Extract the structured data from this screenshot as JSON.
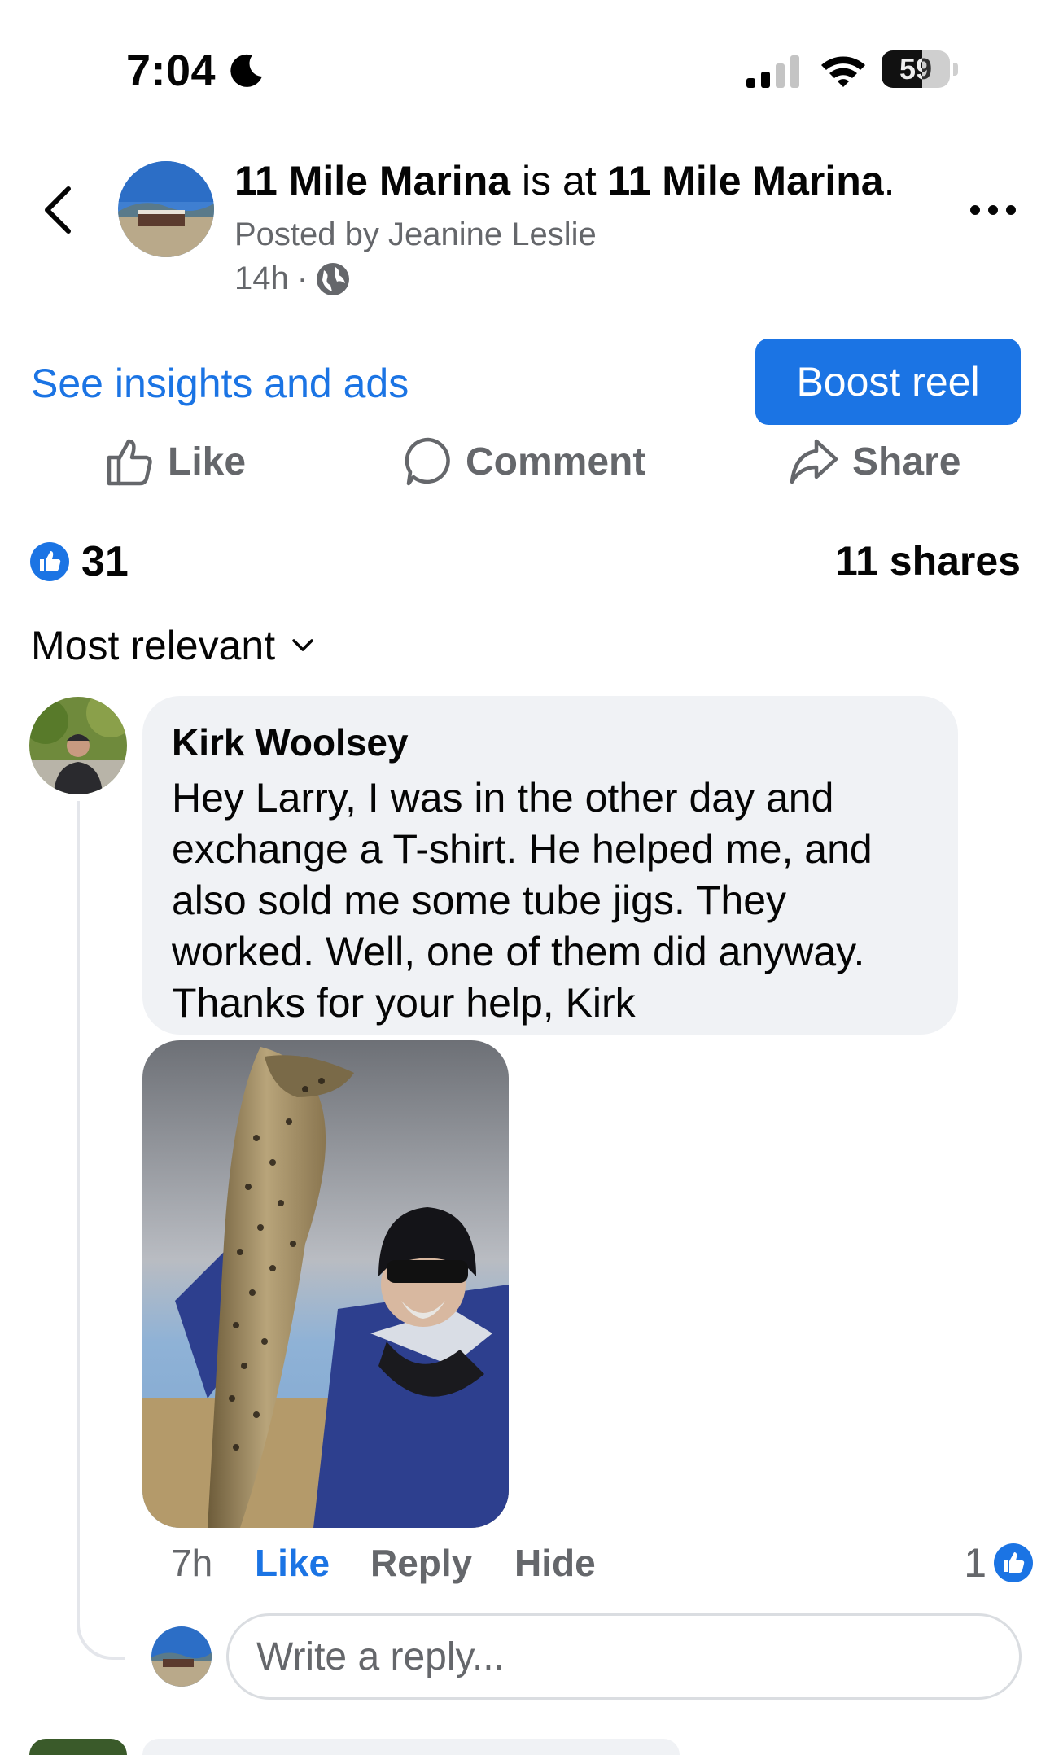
{
  "status_bar": {
    "time": "7:04",
    "battery": "59",
    "battery_level": 0.59
  },
  "header": {
    "page_name": "11 Mile Marina",
    "connector": " is at ",
    "location": "11 Mile Marina",
    "end": ".",
    "posted_by": "Posted by Jeanine Leslie",
    "age": "14h",
    "dot": "·",
    "privacy_icon": "globe-icon"
  },
  "promo": {
    "insights": "See insights and ads",
    "boost": "Boost reel"
  },
  "actions": {
    "like": "Like",
    "comment": "Comment",
    "share": "Share"
  },
  "stats": {
    "reactions": "31",
    "shares": "11 shares"
  },
  "sort": {
    "label": "Most relevant"
  },
  "comment": {
    "author": "Kirk Woolsey",
    "text": "Hey Larry, I was in the other day and exchange a T-shirt. He helped me, and also sold me some tube jigs.  They worked. Well, one of them did anyway. Thanks for your help, Kirk",
    "time": "7h",
    "like": "Like",
    "reply": "Reply",
    "hide": "Hide",
    "reactions": "1"
  },
  "reply_box": {
    "placeholder": "Write a reply..."
  },
  "colors": {
    "brand": "#1b74e4",
    "secondary_text": "#65676b",
    "bubble": "#f0f2f5"
  }
}
